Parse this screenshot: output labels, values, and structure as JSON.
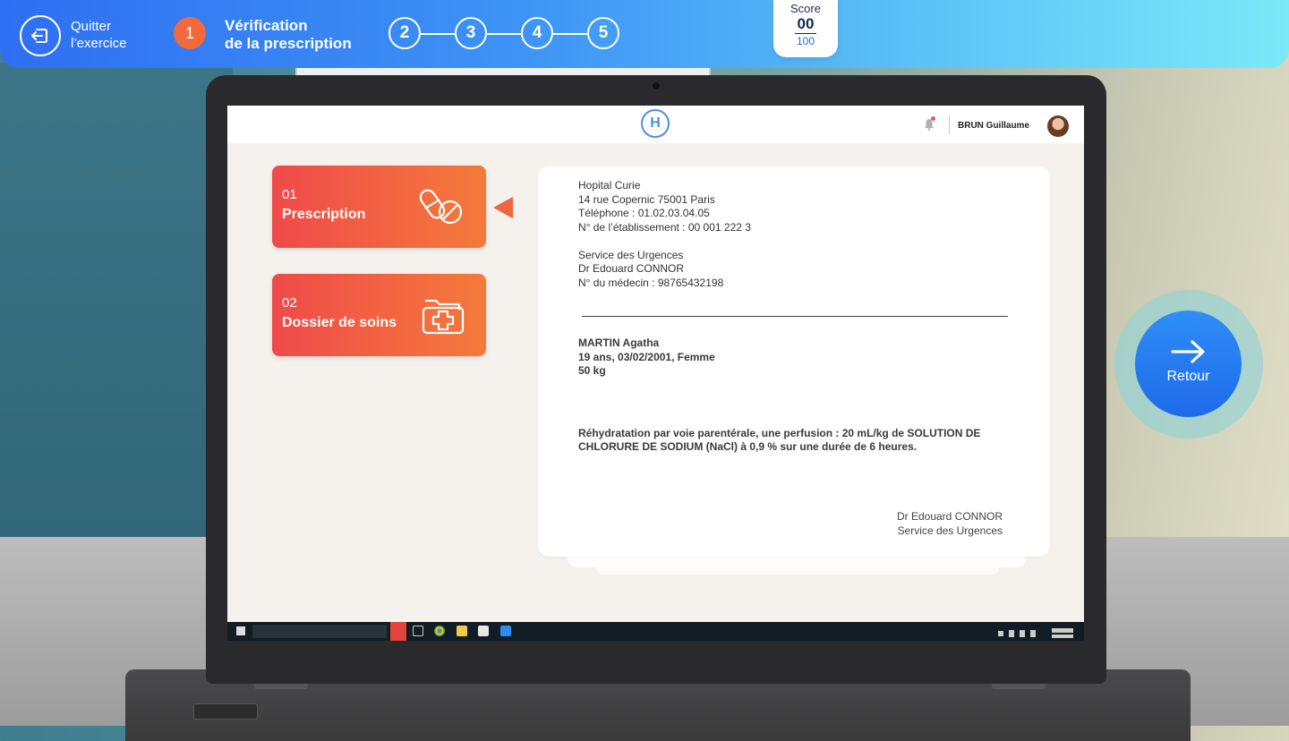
{
  "topbar": {
    "quit_label_1": "Quitter",
    "quit_label_2": "l’exercice",
    "active_step_number": "1",
    "active_step_title_1": "Vérification",
    "active_step_title_2": "de la prescription",
    "steps": [
      "2",
      "3",
      "4",
      "5"
    ]
  },
  "score": {
    "label": "Score",
    "value": "00",
    "max": "100"
  },
  "retour": {
    "label": "Retour",
    "icon": "arrow-right-icon"
  },
  "app": {
    "logo_letter": "H",
    "user_name": "BRUN Guillaume"
  },
  "cards": [
    {
      "number": "01",
      "label": "Prescription",
      "icon": "pills-icon"
    },
    {
      "number": "02",
      "label": "Dossier de soins",
      "icon": "medical-folder-icon"
    }
  ],
  "document": {
    "hospital": "Hopital Curie",
    "address": "14 rue Copernic 75001 Paris",
    "phone": "Téléphone : 01.02.03.04.05",
    "establishment": "N° de l’établissement :  00 001 222 3",
    "service": "Service des Urgences",
    "doctor": "Dr Edouard CONNOR",
    "doctor_number": "N° du médecin : 98765432198",
    "patient_name": "MARTIN Agatha",
    "patient_info": "19 ans, 03/02/2001, Femme",
    "patient_weight": "50 kg",
    "prescription": "Réhydratation par voie parentérale, une perfusion : 20 mL/kg de SOLUTION DE CHLORURE DE SODIUM (NaCl) à 0,9 % sur une durée de 6 heures.",
    "signature_name": "Dr Edouard CONNOR",
    "signature_service": "Service des Urgences"
  },
  "colors": {
    "accent_orange": "#f26a3b",
    "card_gradient_start": "#ef4a4a",
    "card_gradient_end": "#f57a3a",
    "topbar_blue": "#2f6ff2",
    "retour_blue": "#1f6ae8"
  }
}
